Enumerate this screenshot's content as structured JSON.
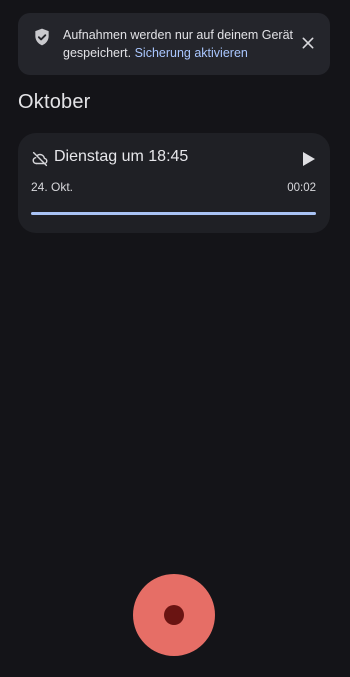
{
  "banner": {
    "message": "Aufnahmen werden nur auf deinem Gerät gespeichert.",
    "link_label": "Sicherung aktivieren",
    "icon": "shield-check-icon",
    "close_icon": "close-icon"
  },
  "section": {
    "month": "Oktober"
  },
  "recordings": [
    {
      "title": "Dienstag um 18:45",
      "date": "24. Okt.",
      "duration": "00:02",
      "progress": 1.0,
      "cloud_status_icon": "cloud-off-icon",
      "play_icon": "play-icon"
    }
  ],
  "record_button": {
    "icon": "record-dot-icon"
  },
  "colors": {
    "background": "#141418",
    "banner_bg": "#24252b",
    "card_bg": "#1f2025",
    "link": "#aac7ff",
    "progress": "#a9c3f5",
    "record_button": "#e66e66",
    "record_dot": "#6a1412"
  }
}
